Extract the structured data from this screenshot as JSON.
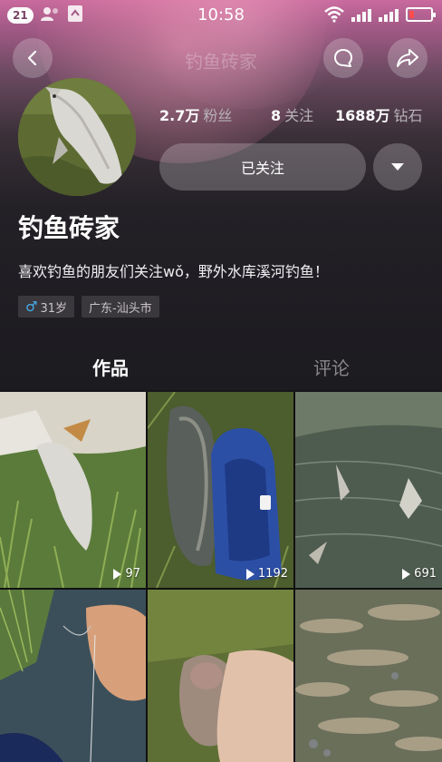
{
  "status_bar": {
    "notification_count": "21",
    "time": "10:58"
  },
  "nav": {
    "title": "钓鱼砖家",
    "icons": [
      "back-icon",
      "chat-bubble-icon",
      "share-icon"
    ]
  },
  "profile": {
    "name": "钓鱼砖家",
    "bio": "喜欢钓鱼的朋友们关注wǒ，野外水库溪河钓鱼！",
    "stats": [
      {
        "value": "2.7万",
        "label": "粉丝"
      },
      {
        "value": "8",
        "label": "关注"
      },
      {
        "value": "1688万",
        "label": "钻石"
      }
    ],
    "follow_button": "已关注",
    "tags": {
      "age": "31岁",
      "location": "广东-汕头市"
    }
  },
  "tabs": [
    {
      "label": "作品",
      "active": true
    },
    {
      "label": "评论",
      "active": false
    }
  ],
  "videos": [
    {
      "plays": "97"
    },
    {
      "plays": "1192"
    },
    {
      "plays": "691"
    },
    {
      "plays": ""
    },
    {
      "plays": ""
    },
    {
      "plays": ""
    }
  ],
  "colors": {
    "header_pink": "#c96a9e",
    "background": "#1c1b20",
    "male_icon": "#44aef0",
    "battery_low": "#ff4d4d"
  }
}
